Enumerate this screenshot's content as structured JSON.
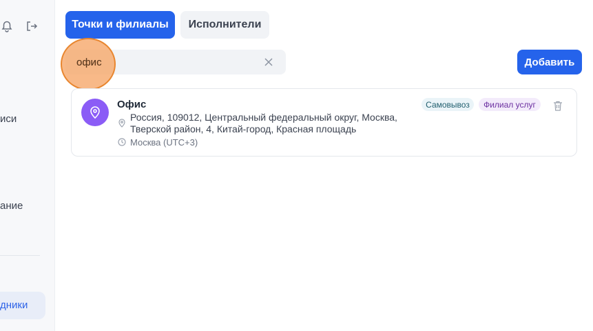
{
  "sidebar": {
    "items": [
      {
        "label": "иси"
      },
      {
        "label": "ание"
      }
    ],
    "active_item": {
      "label": "дники"
    }
  },
  "tabs": [
    {
      "label": "Точки и филиалы",
      "active": true
    },
    {
      "label": "Исполнители",
      "active": false
    }
  ],
  "search": {
    "value": "офис"
  },
  "toolbar": {
    "add_label": "Добавить"
  },
  "locations": [
    {
      "name": "Офис",
      "address": "Россия, 109012, Центральный федеральный округ, Москва, Тверской район, 4, Китай-город, Красная площадь",
      "timezone": "Москва (UTC+3)",
      "badges": [
        "Самовывоз",
        "Филиал услуг"
      ]
    }
  ],
  "colors": {
    "primary": "#2563eb",
    "avatar": "#8b5cf6",
    "click_marker": "#f6a86a"
  }
}
